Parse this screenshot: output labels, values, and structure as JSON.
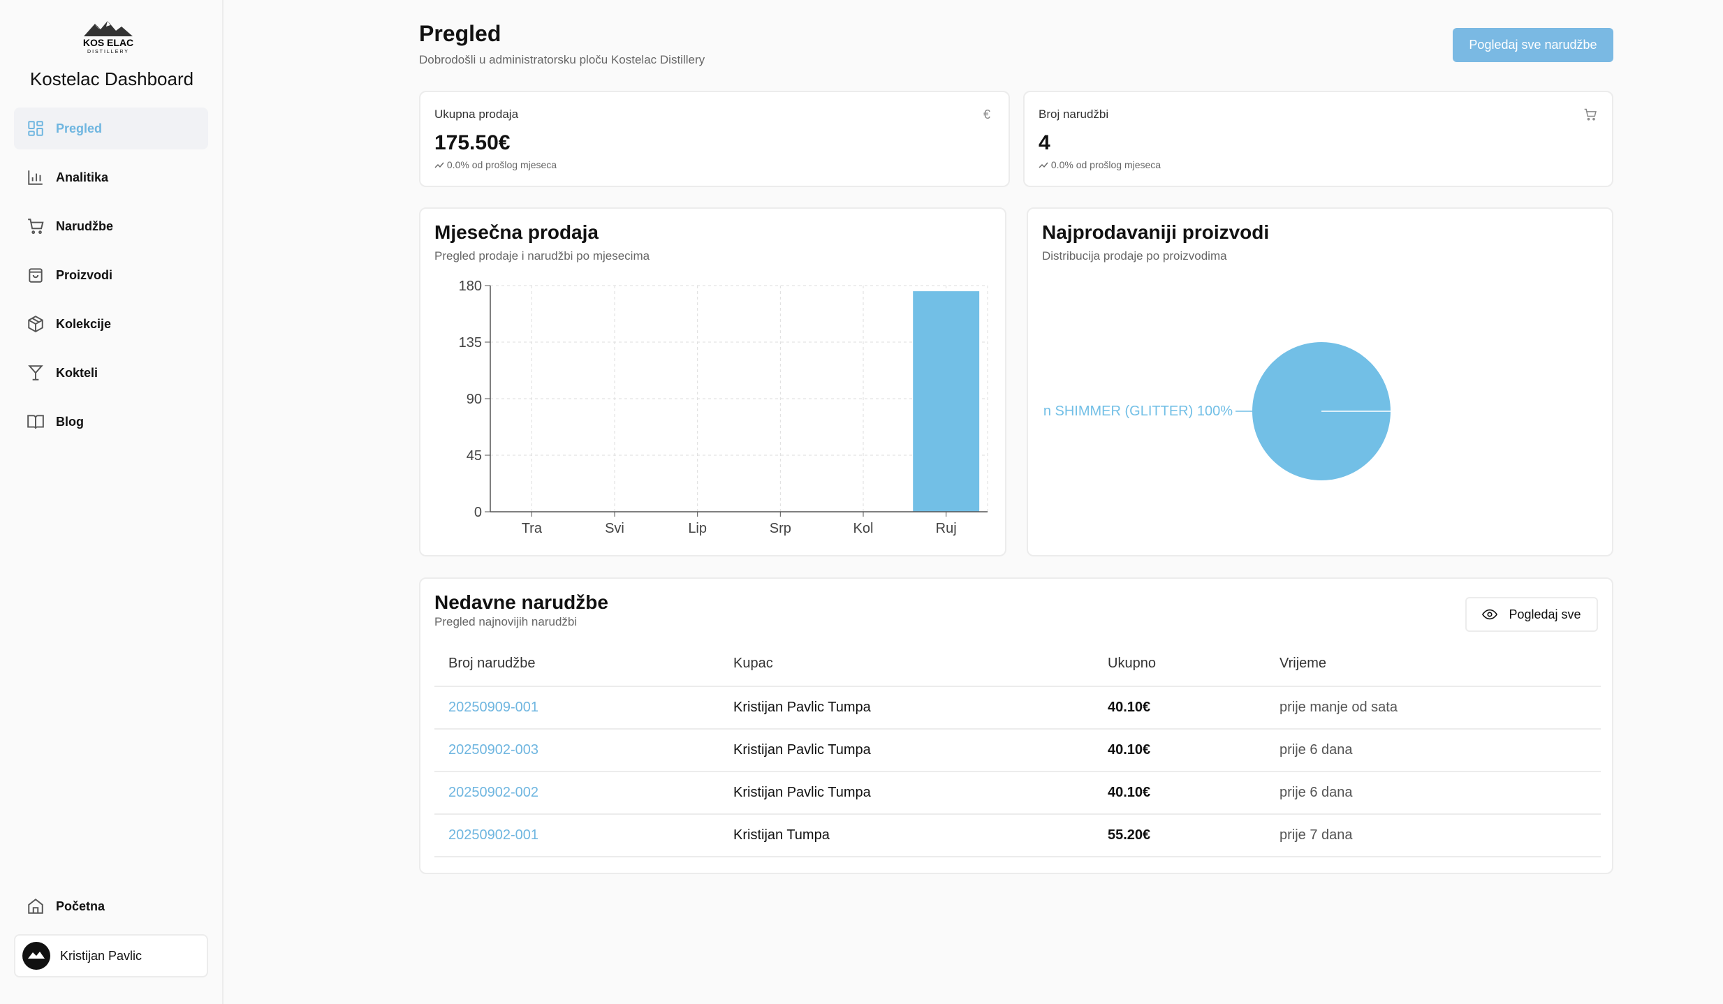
{
  "sidebar": {
    "brand": "Kostelac Dashboard",
    "logo_text_top": "KOS ELAC",
    "logo_text_bottom": "DISTILLERY",
    "items": [
      {
        "label": "Pregled",
        "icon": "grid-icon",
        "active": true
      },
      {
        "label": "Analitika",
        "icon": "bar-chart-icon"
      },
      {
        "label": "Narudžbe",
        "icon": "cart-icon"
      },
      {
        "label": "Proizvodi",
        "icon": "bag-icon"
      },
      {
        "label": "Kolekcije",
        "icon": "box-icon"
      },
      {
        "label": "Kokteli",
        "icon": "cocktail-icon"
      },
      {
        "label": "Blog",
        "icon": "book-icon"
      }
    ],
    "home_label": "Početna",
    "user_name": "Kristijan Pavlic"
  },
  "header": {
    "title": "Pregled",
    "subtitle": "Dobrodošli u administratorsku ploču Kostelac Distillery",
    "view_all_orders": "Pogledaj sve narudžbe"
  },
  "stats": [
    {
      "label": "Ukupna prodaja",
      "value": "175.50€",
      "change": "0.0% od prošlog mjeseca",
      "icon": "euro-icon"
    },
    {
      "label": "Broj narudžbi",
      "value": "4",
      "change": "0.0% od prošlog mjeseca",
      "icon": "cart-icon"
    }
  ],
  "monthly": {
    "title": "Mjesečna prodaja",
    "subtitle": "Pregled prodaje i narudžbi po mjesecima"
  },
  "top_products": {
    "title": "Najprodavaniji proizvodi",
    "subtitle": "Distribucija prodaje po proizvodima",
    "slice_label": "n SHIMMER (GLITTER) 100%"
  },
  "chart_data": [
    {
      "type": "bar",
      "categories": [
        "Tra",
        "Svi",
        "Lip",
        "Srp",
        "Kol",
        "Ruj"
      ],
      "values": [
        0,
        0,
        0,
        0,
        0,
        175.5
      ],
      "yticks": [
        0,
        45,
        90,
        135,
        180
      ],
      "ylim": [
        0,
        180
      ],
      "grid": true,
      "bar_color": "#72bfe6"
    },
    {
      "type": "pie",
      "slices": [
        {
          "label": "n SHIMMER (GLITTER) 100%",
          "value": 100
        }
      ],
      "color": "#72bfe6"
    }
  ],
  "recent_orders": {
    "title": "Nedavne narudžbe",
    "subtitle": "Pregled najnovijih narudžbi",
    "view_all": "Pogledaj sve",
    "columns": [
      "Broj narudžbe",
      "Kupac",
      "Ukupno",
      "Vrijeme"
    ],
    "rows": [
      {
        "number": "20250909-001",
        "customer": "Kristijan Pavlic Tumpa",
        "total": "40.10€",
        "time": "prije manje od sata"
      },
      {
        "number": "20250902-003",
        "customer": "Kristijan Pavlic Tumpa",
        "total": "40.10€",
        "time": "prije 6 dana"
      },
      {
        "number": "20250902-002",
        "customer": "Kristijan Pavlic Tumpa",
        "total": "40.10€",
        "time": "prije 6 dana"
      },
      {
        "number": "20250902-001",
        "customer": "Kristijan Tumpa",
        "total": "55.20€",
        "time": "prije 7 dana"
      }
    ]
  },
  "colors": {
    "accent": "#6fb6e0",
    "button": "#7ab9e3"
  }
}
